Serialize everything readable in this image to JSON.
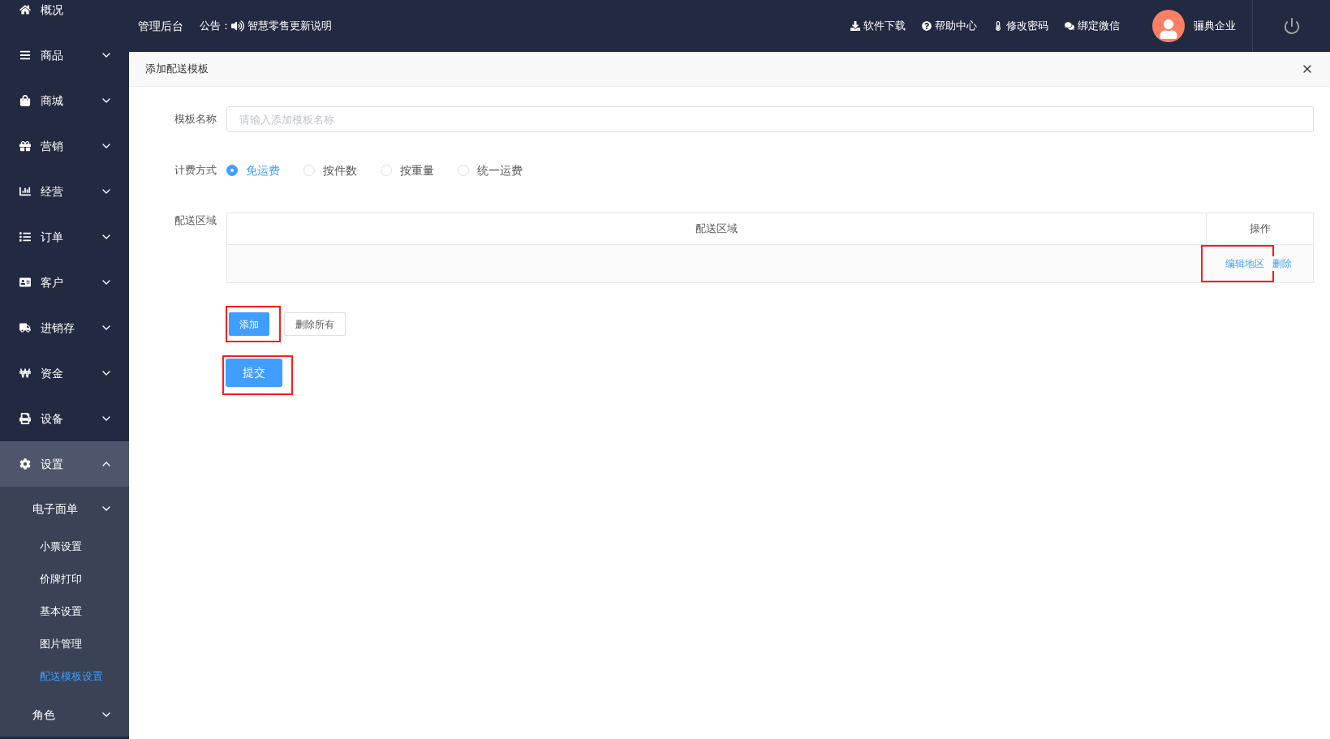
{
  "sidebar": {
    "items": [
      {
        "label": "概况"
      },
      {
        "label": "商品",
        "expanded": false
      },
      {
        "label": "商城",
        "expanded": false
      },
      {
        "label": "营销",
        "expanded": false
      },
      {
        "label": "经营",
        "expanded": false
      },
      {
        "label": "订单",
        "expanded": false
      },
      {
        "label": "客户",
        "expanded": false
      },
      {
        "label": "进销存",
        "expanded": false
      },
      {
        "label": "资金",
        "expanded": false
      },
      {
        "label": "设备",
        "expanded": false
      },
      {
        "label": "设置",
        "expanded": true,
        "children": [
          {
            "label": "电子面单",
            "expanded": false
          },
          {
            "label": "小票设置",
            "selected": false
          },
          {
            "label": "价牌打印",
            "selected": false
          },
          {
            "label": "基本设置",
            "selected": false
          },
          {
            "label": "图片管理",
            "selected": false
          },
          {
            "label": "配送模板设置",
            "selected": true
          },
          {
            "label": "角色",
            "expanded": false
          }
        ]
      }
    ]
  },
  "topbar": {
    "title": "管理后台",
    "notice_label": "公告：",
    "notice": "智慧零售更新说明",
    "links": [
      {
        "label": "软件下载"
      },
      {
        "label": "帮助中心"
      },
      {
        "label": "修改密码"
      },
      {
        "label": "绑定微信"
      }
    ],
    "user": "骊典企业"
  },
  "dialog": {
    "title": "添加配送模板",
    "name_field": {
      "label": "模板名称",
      "placeholder": "请输入添加模板名称"
    },
    "billing": {
      "label": "计费方式",
      "options": [
        {
          "label": "免运费",
          "selected": true
        },
        {
          "label": "按件数",
          "selected": false
        },
        {
          "label": "按重量",
          "selected": false
        },
        {
          "label": "统一运费",
          "selected": false
        }
      ]
    },
    "area": {
      "label": "配送区域",
      "columns": [
        "配送区域",
        "操作"
      ],
      "rows": [
        {
          "actions": [
            {
              "label": "编辑地区"
            },
            {
              "label": "删除"
            }
          ],
          "highlighted": true
        }
      ]
    },
    "buttons": [
      {
        "label": "添加",
        "kind": "primary",
        "highlighted": true
      },
      {
        "label": "删除所有",
        "kind": "plain",
        "highlighted": false
      }
    ],
    "submit": {
      "label": "提交",
      "highlighted": true
    }
  }
}
